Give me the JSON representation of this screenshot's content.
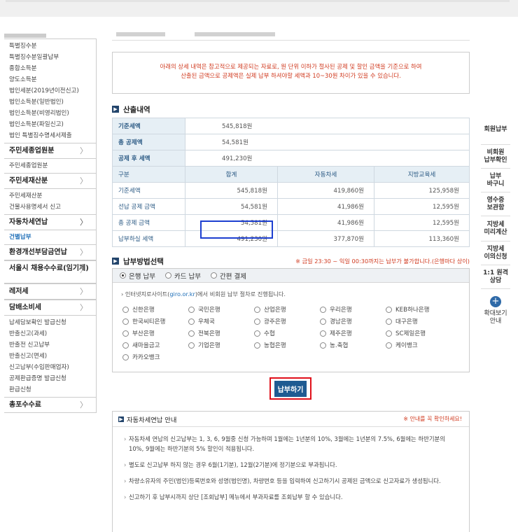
{
  "leftnav": {
    "group1": [
      "특별징수분",
      "특별징수분일괄납부",
      "종합소득분",
      "양도소득분",
      "법인세분(2019년이전신고)",
      "법인소득분(일반법인)",
      "법인소득분(비영리법인)",
      "법인소득분(파일신고)",
      "법인 특별징수명세서제출"
    ],
    "cat_resident_employee": "주민세종업원분",
    "sub_resident_employee": [
      "주민세종업원분"
    ],
    "cat_resident_property": "주민세재산분",
    "sub_resident_property": [
      "주민세재산분",
      "건물사용명세서 신고"
    ],
    "cat_car_annual": "자동차세연납",
    "sub_car_annual": [
      "건별납부"
    ],
    "cat_env": "환경개선부담금연납",
    "cat_seoul": "서울시 채용수수료(임기제)",
    "cat_leisure": "레저세",
    "cat_tobacco": "담배소비세",
    "sub_tobacco": [
      "납세담보확인 발급신청",
      "반출신고(과세)",
      "반출전 신고납부",
      "반출신고(면세)",
      "신고납부(수입판매업자)",
      "공제환급증명 발급신청",
      "환급신청"
    ],
    "cat_total": "총포수수료",
    "chevron": "〉"
  },
  "notice": {
    "line1": "아래의 상세 내역은 참고적으로 제공되는 자료로, 원 단위 이하가 절사된 공제 및 할인 금액을 기준으로 하여",
    "line2": "산출된 금액으로 공제액은 실제 납부 하셔야할 세액과 10~30원 차이가 있을 수 있습니다."
  },
  "calc": {
    "title": "산출내역",
    "base_label": "기준세액",
    "base_value": "545,818원",
    "deduct_label": "총 공제액",
    "deduct_value": "54,581원",
    "after_label": "공제 후 세액",
    "after_value": "491,230원",
    "col_headers": [
      "구분",
      "합계",
      "자동차세",
      "지방교육세"
    ],
    "rows": [
      {
        "label": "기준세액",
        "total": "545,818원",
        "car": "419,860원",
        "edu": "125,958원"
      },
      {
        "label": "선납 공제 금액",
        "total": "54,581원",
        "car": "41,986원",
        "edu": "12,595원"
      },
      {
        "label": "총 공제 금액",
        "total": "54,581원",
        "car": "41,986원",
        "edu": "12,595원"
      },
      {
        "label": "납부하실 세액",
        "total": "491,230원",
        "car": "377,870원",
        "edu": "113,360원"
      }
    ]
  },
  "payment": {
    "title": "납부방법선택",
    "warning": "※ 금일 23:30 ~ 익일 00:30까지는 납부가 불가합니다.(은행마다 상이)",
    "tabs": [
      "은행 납부",
      "카드 납부",
      "간편 결제"
    ],
    "note_pre": "인터넷지로사이트(",
    "note_link": "giro.or.kr",
    "note_post": ")에서 비회원 납부 절차로 진행됩니다.",
    "banks": [
      "신한은행",
      "국민은행",
      "산업은행",
      "우리은행",
      "KEB하나은행",
      "한국씨티은행",
      "우체국",
      "광주은행",
      "경남은행",
      "대구은행",
      "부산은행",
      "전북은행",
      "수협",
      "제주은행",
      "SC제일은행",
      "새마을금고",
      "기업은행",
      "농협은행",
      "농.축협",
      "케이뱅크",
      "카카오뱅크"
    ],
    "pay_button": "납부하기"
  },
  "info": {
    "title": "자동차세연납 안내",
    "right_note": "※ 안내를 꼭 확인하세요!",
    "items": [
      "자동차세 연납의 신고납부는 1, 3, 6, 9월중 신청 가능하며 1월에는 1년분의 10%, 3월에는 1년분의 7.5%, 6월에는 하반기분의 10%, 9월에는 하반기분의 5% 할인이 적용됩니다.",
      "별도로 신고납부 하지 않는 경우 6월(1기분), 12월(2기분)에 정기분으로 부과됩니다.",
      "차량소유자의 주민(법인)등록번호와 성명(법인명), 차량번호 등을 입력하여 신고하기시 공제된 금액으로 신고자료가 생성됩니다.",
      "신고하기 후 납부시까지 상단 [조회납부] 메뉴에서 부과자료를 조회납부 할 수 있습니다."
    ]
  },
  "quickmenu": {
    "items": [
      "회원납부",
      "비회원\n납부확인",
      "납부\n바구니",
      "영수증\n보관함",
      "지방세\n미리계산",
      "지방세\n이의신청",
      "1:1 원격\n상담"
    ],
    "zoom": "확대보기\n안내",
    "plus": "+"
  }
}
